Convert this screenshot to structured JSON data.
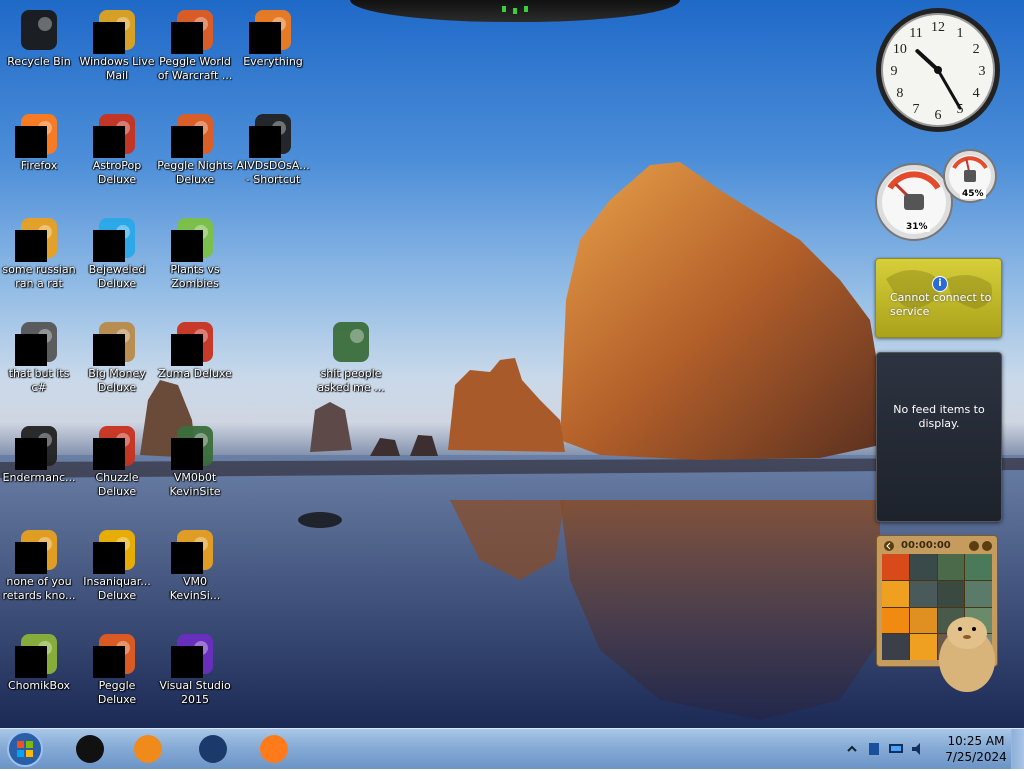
{
  "desktop": {
    "icons": [
      {
        "label": "Recycle Bin",
        "icon": "recycle-bin-icon"
      },
      {
        "label": "Windows Live\nMail",
        "icon": "mail-icon"
      },
      {
        "label": "Peggle World\nof Warcraft ...",
        "icon": "peggle-icon"
      },
      {
        "label": "Everything",
        "icon": "search-icon"
      },
      {
        "label": "Firefox",
        "icon": "firefox-icon"
      },
      {
        "label": "AstroPop\nDeluxe",
        "icon": "game-icon"
      },
      {
        "label": "Peggle Nights\nDeluxe",
        "icon": "peggle-icon"
      },
      {
        "label": "AIVDsDOsA...\n- Shortcut",
        "icon": "shortcut-icon"
      },
      {
        "label": "some russian\nran a rat",
        "icon": "app-icon"
      },
      {
        "label": "Bejeweled\nDeluxe",
        "icon": "gem-icon"
      },
      {
        "label": "Plants vs\nZombies",
        "icon": "plant-icon"
      },
      {
        "label": "that but its c#",
        "icon": "file-icon"
      },
      {
        "label": "Big Money\nDeluxe",
        "icon": "money-bag-icon"
      },
      {
        "label": "Zuma Deluxe",
        "icon": "game-icon"
      },
      {
        "label": "shit people\nasked me ...",
        "icon": "folder-icon"
      },
      {
        "label": "Endermanc...",
        "icon": "terminal-icon"
      },
      {
        "label": "Chuzzle\nDeluxe",
        "icon": "game-icon"
      },
      {
        "label": "VM0b0t\nKevinSite",
        "icon": "folder-icon"
      },
      {
        "label": "none of you\nretards kno...",
        "icon": "app-icon"
      },
      {
        "label": "Insaniquar...\nDeluxe",
        "icon": "fish-icon"
      },
      {
        "label": "VM0\nKevinSi...",
        "icon": "app-icon"
      },
      {
        "label": "ChomikBox",
        "icon": "hamster-icon"
      },
      {
        "label": "Peggle Deluxe",
        "icon": "peggle-icon"
      },
      {
        "label": "Visual Studio\n2015",
        "icon": "visual-studio-icon"
      }
    ]
  },
  "gadgets": {
    "clock": {
      "hour": 10,
      "minute": 25
    },
    "cpu_meter": {
      "cpu_label": "31%",
      "memory_label": "45%",
      "cpu": 31,
      "memory": 45
    },
    "weather": {
      "message": "Cannot connect to service",
      "info_glyph": "i"
    },
    "feed": {
      "message": "No feed items to display."
    },
    "puzzle": {
      "timer": "00:00:00"
    }
  },
  "taskbar": {
    "pinned": [
      {
        "icon": "cmd-icon"
      },
      {
        "icon": "media-player-icon"
      },
      {
        "icon": "globe-icon"
      },
      {
        "icon": "firefox-icon"
      }
    ],
    "clock": {
      "time": "10:25 AM",
      "date": "7/25/2024"
    }
  }
}
